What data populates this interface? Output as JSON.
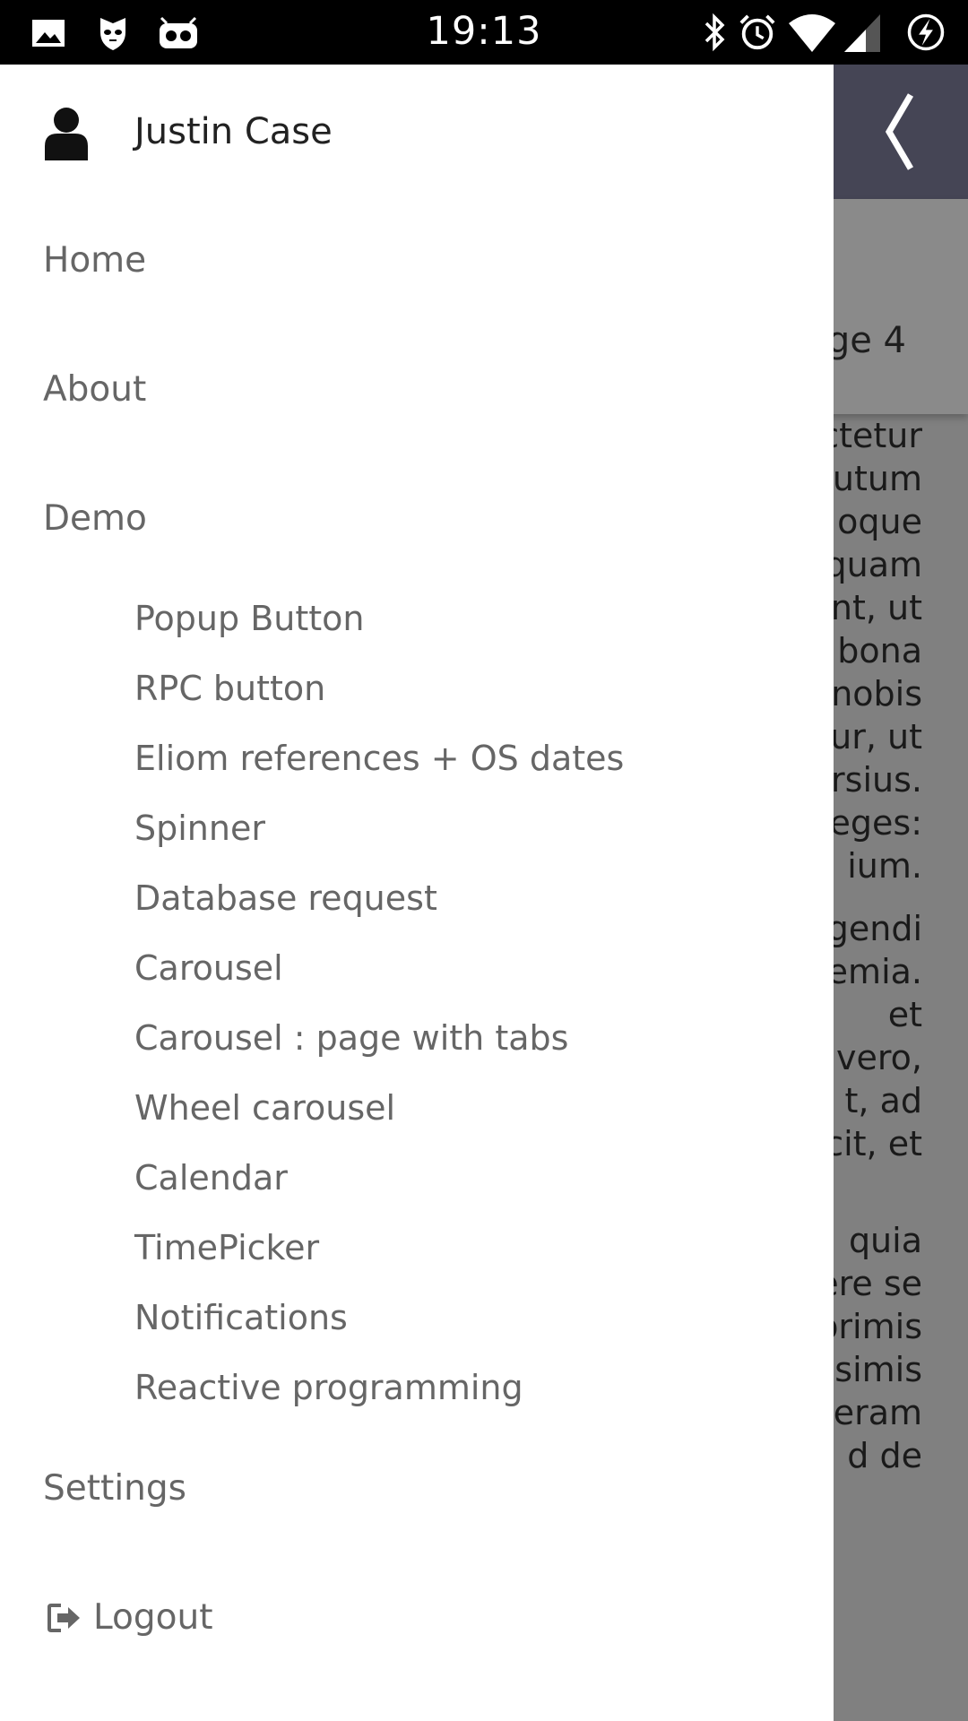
{
  "status_bar": {
    "time": "19:13",
    "left_icons": [
      "image-icon",
      "shield-cat-icon",
      "robot-icon"
    ],
    "right_icons": [
      "bluetooth-icon",
      "alarm-icon",
      "wifi-icon",
      "signal-icon",
      "battery-charging-icon"
    ]
  },
  "app": {
    "header_color": "#454555",
    "back_icon": "chevron-left-icon",
    "page_title_visible": "ge 4",
    "paragraphs": [
      [
        "ctetur",
        "utum",
        "oque",
        "quam",
        "nt, ut",
        "bona",
        "nobis",
        "ur, ut",
        "ersius.",
        "eges:",
        "ium."
      ],
      [
        "gendi",
        "emia.",
        "et",
        "vero,",
        "t, ad",
        "cit, et"
      ],
      [
        "quia",
        "ere se",
        "orimis",
        "ssimis",
        "eram",
        "d de"
      ]
    ]
  },
  "drawer": {
    "user": {
      "icon": "user-icon",
      "name": "Justin Case"
    },
    "items": {
      "home": "Home",
      "about": "About",
      "demo": "Demo",
      "settings": "Settings",
      "logout": "Logout"
    },
    "demo_items": [
      "Popup Button",
      "RPC button",
      "Eliom references + OS dates",
      "Spinner",
      "Database request",
      "Carousel",
      "Carousel : page with tabs",
      "Wheel carousel",
      "Calendar",
      "TimePicker",
      "Notifications",
      "Reactive programming"
    ],
    "logout_icon": "sign-out-icon"
  }
}
